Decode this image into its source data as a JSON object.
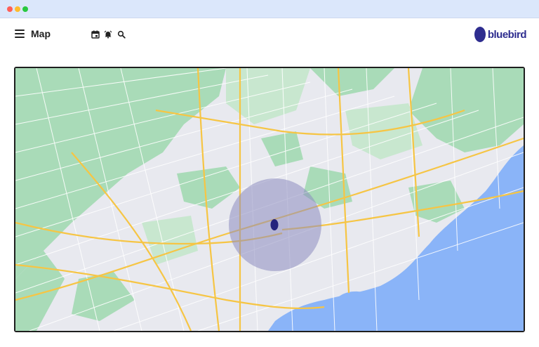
{
  "window": {
    "title": "Map"
  },
  "header": {
    "title": "Map",
    "icons": [
      "menu-icon",
      "calendar-icon",
      "alarm-icon",
      "search-icon"
    ]
  },
  "brand": {
    "name": "bluebird",
    "color": "#2e2d8f"
  },
  "map": {
    "marker_icon": "location-marker-icon",
    "radius_color": "#8c8cc0",
    "water_color": "#8ab4f8",
    "park_color": "#a6d8b5",
    "road_color": "#f6c544"
  }
}
